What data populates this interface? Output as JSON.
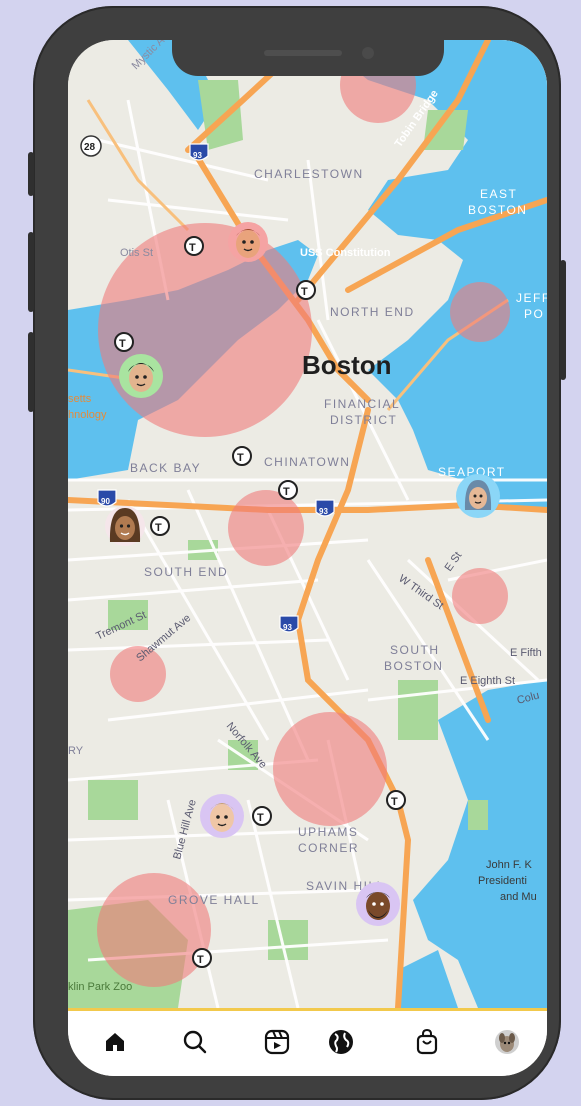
{
  "map": {
    "city": "Boston",
    "districts": {
      "charlestown": "CHARLESTOWN",
      "north_end": "NORTH END",
      "financial": "FINANCIAL",
      "district": "DISTRICT",
      "back_bay": "BACK BAY",
      "chinatown": "CHINATOWN",
      "south_end": "SOUTH END",
      "south": "SOUTH",
      "boston": "BOSTON",
      "east": "EAST",
      "east_boston": "BOSTON",
      "seaport": "SEAPORT",
      "uphams": "UPHAMS",
      "corner": "CORNER",
      "savin_hill": "SAVIN HILL",
      "grove_hall": "GROVE HALL",
      "jeff": "JEFF",
      "po": "PO"
    },
    "streets": {
      "mystic_ave": "Mystic Ave",
      "tobin_bridge": "Tobin Bridge",
      "otis_st": "Otis St",
      "tremont_st": "Tremont St",
      "shawmut_ave": "Shawmut Ave",
      "w_third_st": "W Third St",
      "e_st": "E St",
      "e_fifth": "E Fifth",
      "e_eighth_st": "E Eighth St",
      "norfolk_ave": "Norfolk Ave",
      "blue_hill_ave": "Blue Hill Ave",
      "colu": "Colu"
    },
    "places": {
      "uss_constitution": "USS Constitution",
      "mit_1": "setts",
      "mit_2": "hnology",
      "zoo": "klin Park Zoo",
      "jfk_1": "John F. K",
      "jfk_2": "Presidenti",
      "jfk_3": "and Mu",
      "ry": "RY"
    },
    "shields": {
      "route_28": "28",
      "i93": "93",
      "i90": "90"
    },
    "transit_symbol": "T"
  },
  "nav": {
    "items": [
      "home",
      "search",
      "reels",
      "explore",
      "shop",
      "profile"
    ]
  },
  "colors": {
    "heat": "#f07c7c",
    "water": "#5ec0ee",
    "highway": "#f7a553",
    "park": "#a8d89a",
    "land": "#ecebe4"
  }
}
